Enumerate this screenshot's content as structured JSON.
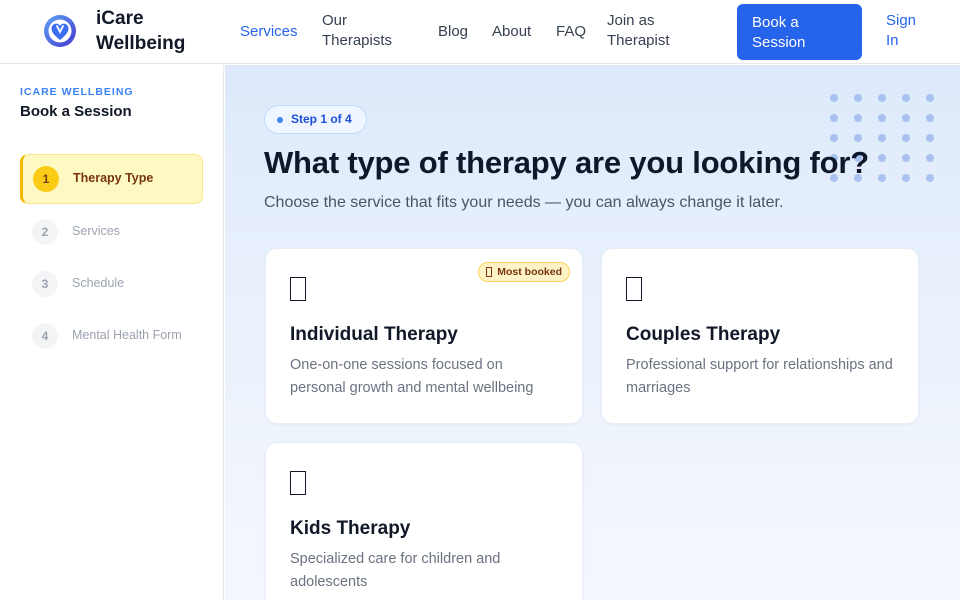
{
  "header": {
    "brand": "iCare Wellbeing",
    "nav": [
      {
        "label": "Services",
        "active": true
      },
      {
        "label": "Our Therapists"
      },
      {
        "label": "Blog"
      },
      {
        "label": "About"
      },
      {
        "label": "FAQ"
      },
      {
        "label": "Join as Therapist"
      }
    ],
    "cta_label": "Book a Session",
    "signin_label": "Sign In",
    "logo_icon": "heart-logo-icon"
  },
  "sidebar": {
    "eyebrow": "ICARE WELLBEING",
    "title": "Book a Session",
    "steps": [
      {
        "number": "1",
        "label": "Therapy Type",
        "active": true
      },
      {
        "number": "2",
        "label": "Services"
      },
      {
        "number": "3",
        "label": "Schedule"
      },
      {
        "number": "4",
        "label": "Mental Health Form"
      }
    ]
  },
  "main": {
    "step_pill": "Step 1 of 4",
    "headline": "What type of therapy are you looking for?",
    "subheadline": "Choose the service that fits your needs — you can always change it later.",
    "cards": [
      {
        "title": "Individual Therapy",
        "description": "One-on-one sessions focused on personal growth and mental wellbeing",
        "badge": "Most booked",
        "icon": "individual-therapy-icon"
      },
      {
        "title": "Couples Therapy",
        "description": "Professional support for relationships and marriages",
        "icon": "couples-therapy-icon"
      },
      {
        "title": "Kids Therapy",
        "description": "Specialized care for children and adolescents",
        "icon": "kids-therapy-icon"
      }
    ]
  },
  "colors": {
    "accent": "#2563eb",
    "active_step": "#facc15",
    "badge": "#fef3c7"
  }
}
